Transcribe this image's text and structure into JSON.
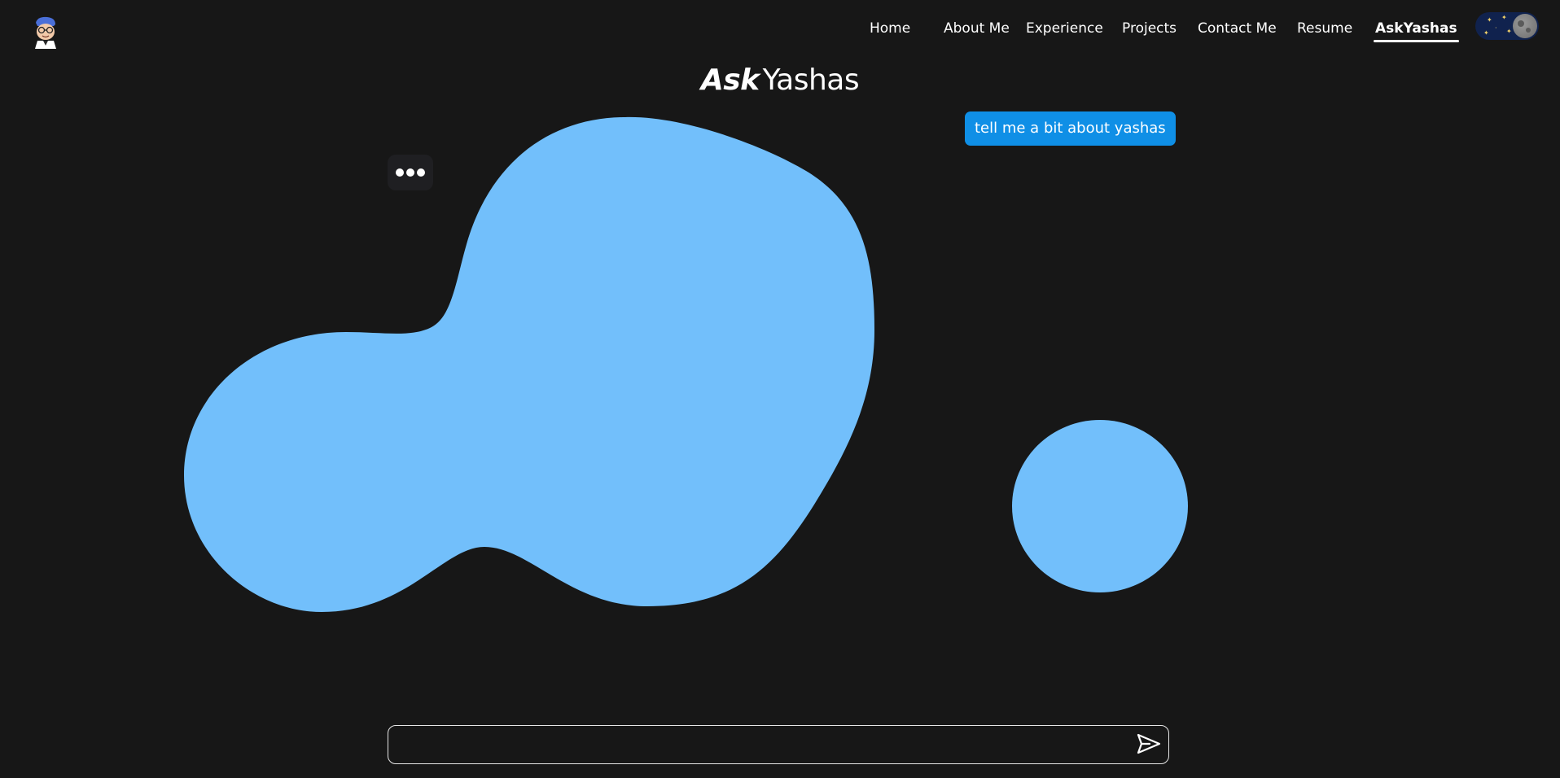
{
  "nav": {
    "items": [
      {
        "label": "Home",
        "active": false
      },
      {
        "label": "About Me",
        "active": false
      },
      {
        "label": "Experience",
        "active": false
      },
      {
        "label": "Projects",
        "active": false
      },
      {
        "label": "Contact Me",
        "active": false
      },
      {
        "label": "Resume",
        "active": false
      },
      {
        "label": "AskYashas",
        "active": true
      }
    ],
    "theme_toggle": "moon-icon"
  },
  "title": {
    "prefix": "Ask",
    "name": "Yashas"
  },
  "chat": {
    "messages": [
      {
        "role": "user",
        "text": "tell me a bit about yashas"
      }
    ],
    "typing_indicator": "loading-dots",
    "input_value": "",
    "input_placeholder": ""
  },
  "colors": {
    "background": "#171717",
    "accent_blob": "#72bffb",
    "user_bubble": "#0f8fe6"
  }
}
